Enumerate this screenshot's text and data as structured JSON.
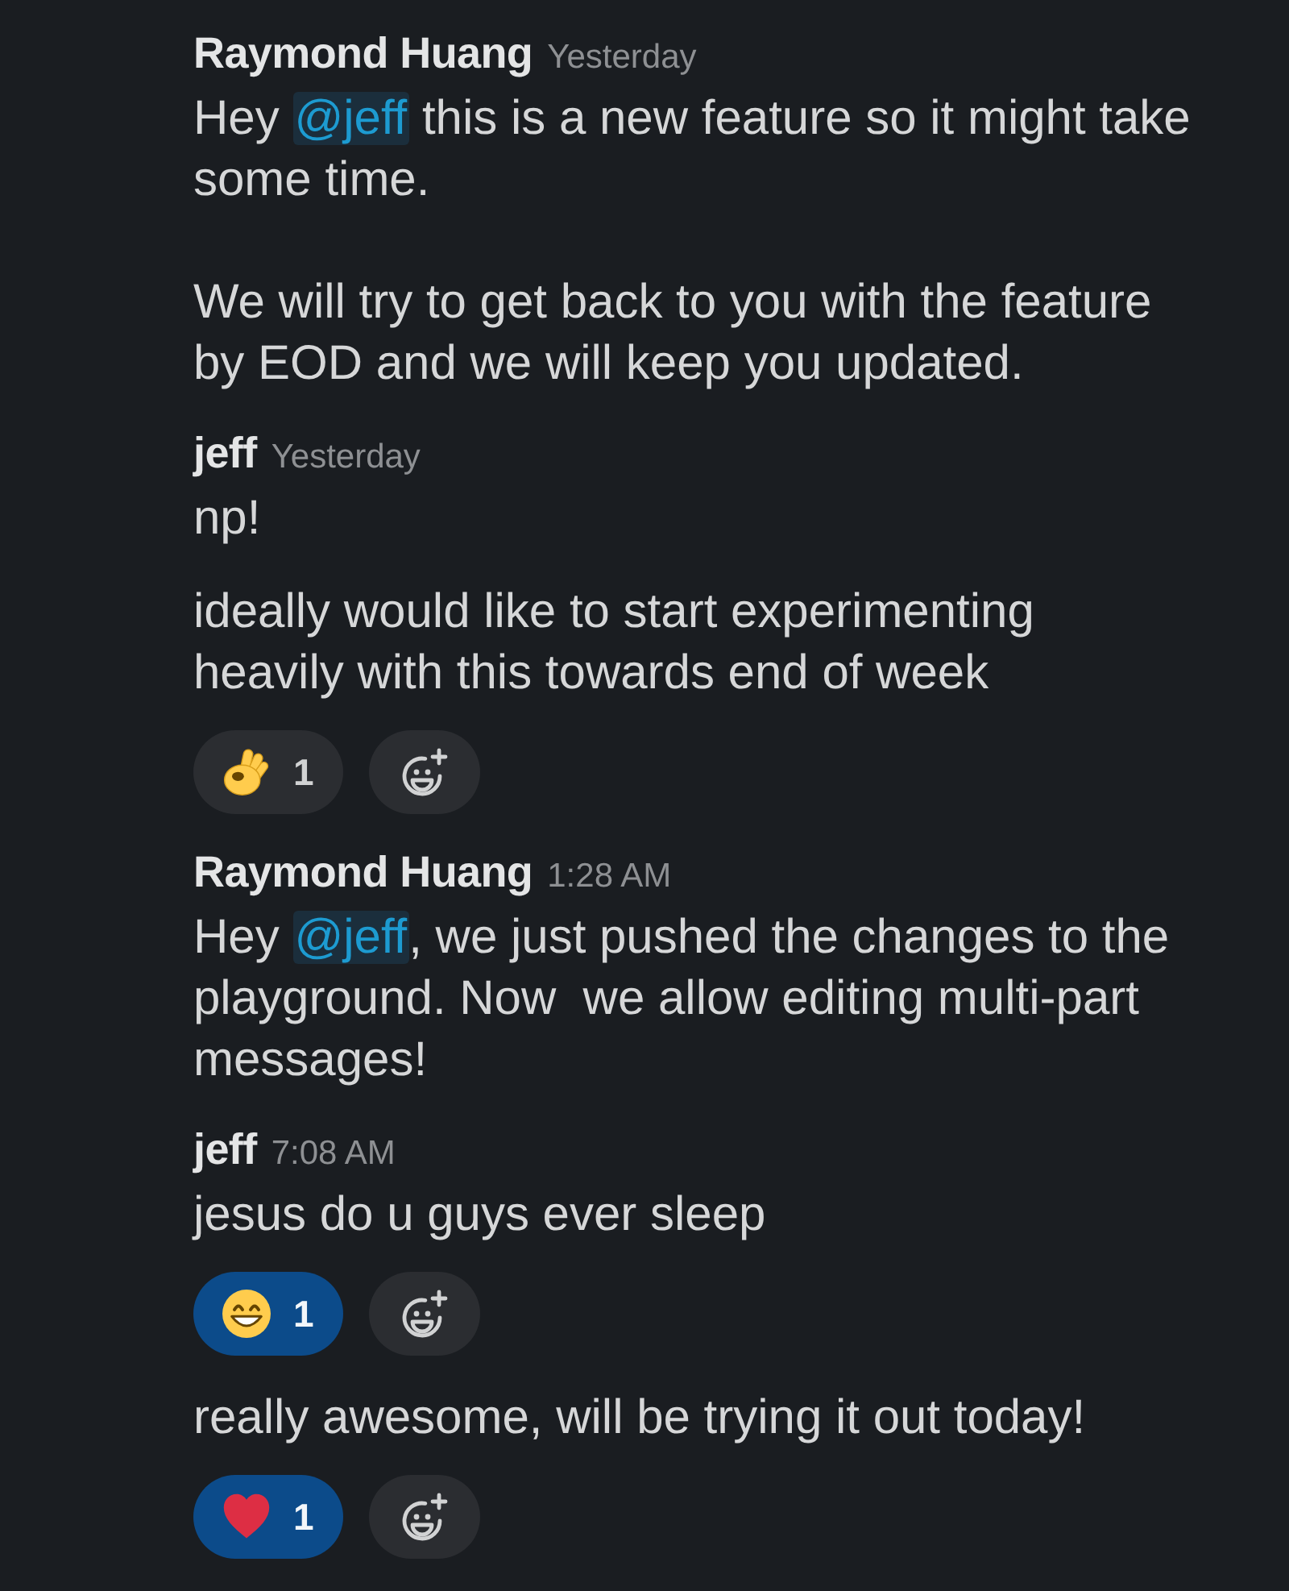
{
  "groups": [
    {
      "author": "Raymond Huang",
      "time": "Yesterday",
      "posts": [
        {
          "paragraphs": [
            [
              {
                "kind": "text",
                "text": "Hey "
              },
              {
                "kind": "mention",
                "text": "@jeff"
              },
              {
                "kind": "text",
                "text": " this is a new feature so it might take some time."
              }
            ],
            [
              {
                "kind": "text",
                "text": "We will try to get back to you with the feature by EOD and we will keep you updated."
              }
            ]
          ]
        }
      ]
    },
    {
      "author": "jeff",
      "time": "Yesterday",
      "posts": [
        {
          "paragraphs": [
            [
              {
                "kind": "text",
                "text": "np!"
              }
            ]
          ]
        },
        {
          "paragraphs": [
            [
              {
                "kind": "text",
                "text": "ideally would like to start experimenting heavily with this towards end of week"
              }
            ]
          ],
          "reactions": [
            {
              "kind": "ok_hand",
              "count": "1",
              "selected": false
            }
          ]
        }
      ]
    },
    {
      "author": "Raymond Huang",
      "time": "1:28 AM",
      "posts": [
        {
          "paragraphs": [
            [
              {
                "kind": "text",
                "text": "Hey "
              },
              {
                "kind": "mention",
                "text": "@jeff"
              },
              {
                "kind": "text",
                "text": ", we just pushed the changes to the playground. Now  we allow editing multi-part messages!"
              }
            ]
          ]
        }
      ]
    },
    {
      "author": "jeff",
      "time": "7:08 AM",
      "posts": [
        {
          "paragraphs": [
            [
              {
                "kind": "text",
                "text": "jesus do u guys ever sleep"
              }
            ]
          ],
          "reactions": [
            {
              "kind": "grinning",
              "count": "1",
              "selected": true
            }
          ]
        },
        {
          "paragraphs": [
            [
              {
                "kind": "text",
                "text": "really awesome, will be trying it out today!"
              }
            ]
          ],
          "reactions": [
            {
              "kind": "heart",
              "count": "1",
              "selected": true
            }
          ]
        }
      ]
    }
  ]
}
